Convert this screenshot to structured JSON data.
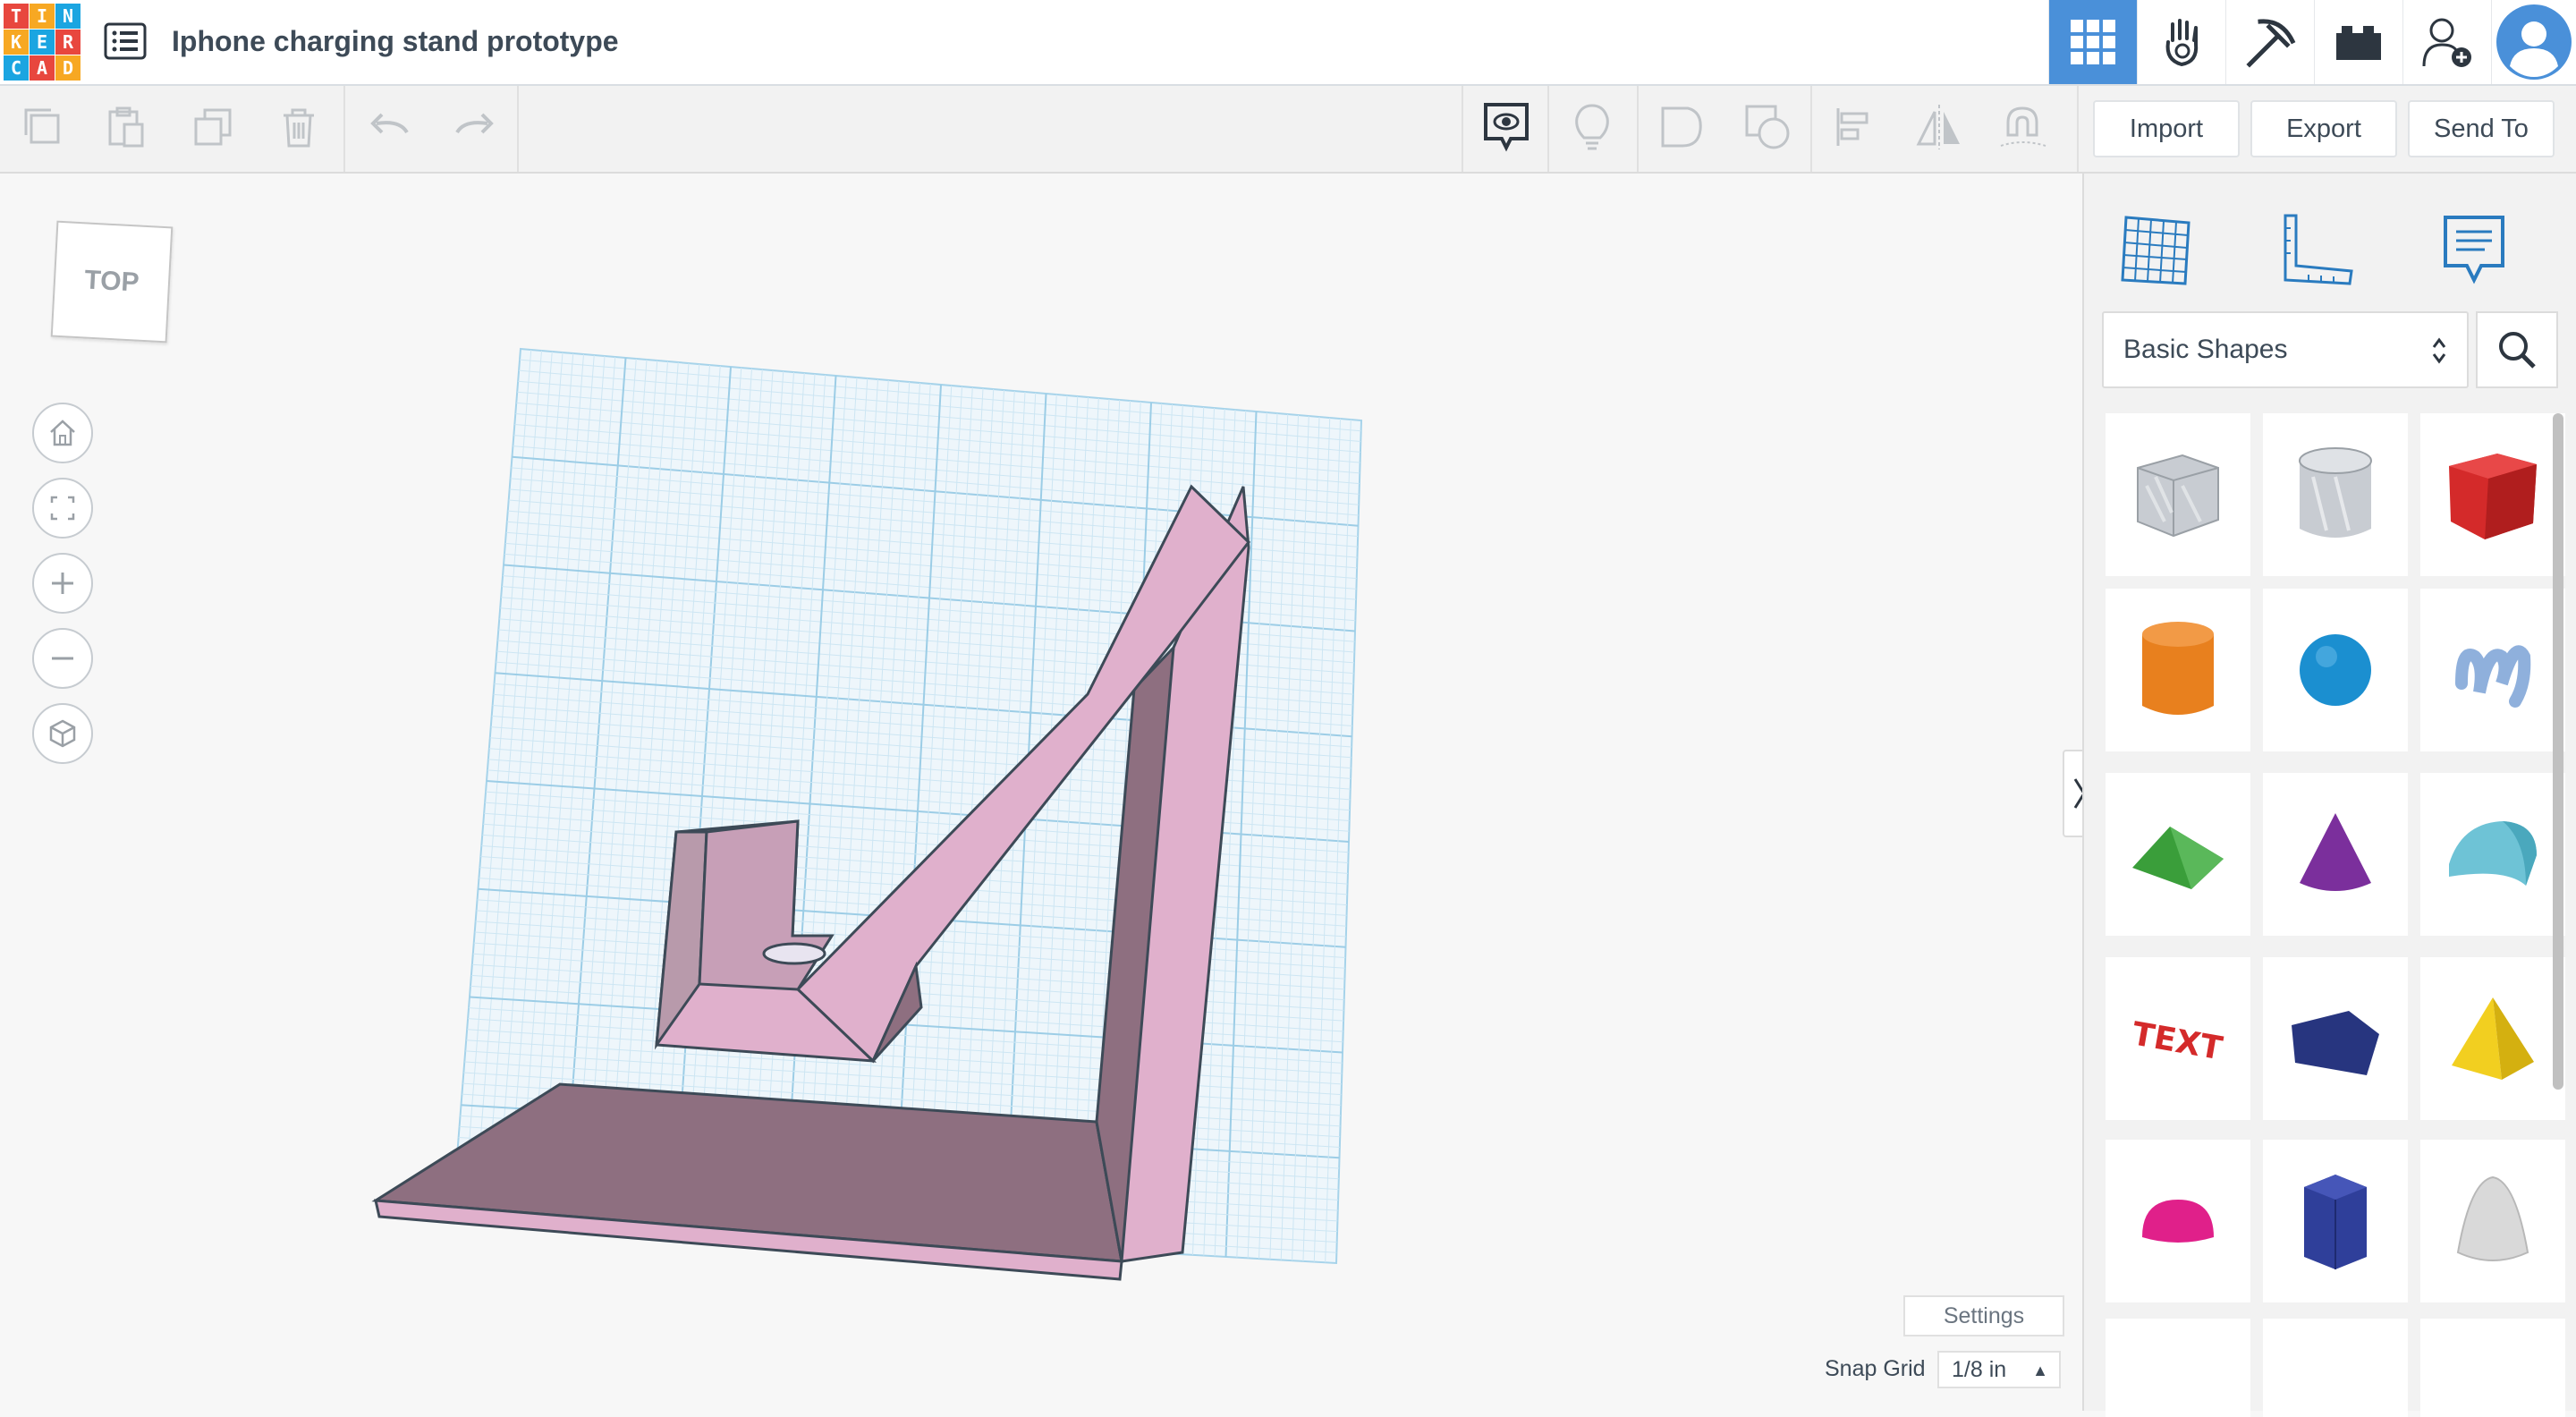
{
  "logo": {
    "letters": [
      "T",
      "I",
      "N",
      "K",
      "E",
      "R",
      "C",
      "A",
      "D"
    ],
    "colors": [
      "#e8473e",
      "#f7a823",
      "#1ba5e1",
      "#f7a823",
      "#1ba5e1",
      "#e8473e",
      "#1ba5e1",
      "#e8473e",
      "#f7a823"
    ]
  },
  "header": {
    "title": "Iphone charging stand prototype"
  },
  "top_icons": [
    "grid-view-icon",
    "gallery-hand-icon",
    "pickaxe-icon",
    "bricks-icon",
    "add-user-icon",
    "user-avatar-icon"
  ],
  "toolbar": {
    "import_label": "Import",
    "export_label": "Export",
    "send_to_label": "Send To",
    "icons": [
      "copy-icon",
      "paste-icon",
      "duplicate-icon",
      "delete-icon",
      "undo-icon",
      "redo-icon",
      "notes-toggle-icon",
      "light-bulb-icon",
      "hole-icon",
      "group-icon",
      "align-icon",
      "mirror-icon",
      "workplane-magnet-icon"
    ]
  },
  "viewcube": {
    "label": "TOP"
  },
  "nav_buttons": [
    "home-view-icon",
    "fit-view-icon",
    "zoom-in-icon",
    "zoom-out-icon",
    "projection-icon"
  ],
  "sidebar": {
    "tabs": [
      "workplane-icon",
      "ruler-icon",
      "notes-icon"
    ],
    "category": "Basic Shapes",
    "shapes": [
      {
        "name": "box-hole",
        "color": "#c8ccd2"
      },
      {
        "name": "cylinder-hole",
        "color": "#c8ccd2"
      },
      {
        "name": "box",
        "color": "#d42a2a"
      },
      {
        "name": "cylinder",
        "color": "#e8801e"
      },
      {
        "name": "sphere",
        "color": "#1b8fd0"
      },
      {
        "name": "scribble",
        "color": "#8fb0dc"
      },
      {
        "name": "roof",
        "color": "#3a9e3a"
      },
      {
        "name": "cone",
        "color": "#7b2f9c"
      },
      {
        "name": "round-roof",
        "color": "#6ec3d6"
      },
      {
        "name": "text",
        "color": "#d42a2a"
      },
      {
        "name": "polygon",
        "color": "#27357f"
      },
      {
        "name": "pyramid",
        "color": "#f2cf20"
      },
      {
        "name": "half-sphere",
        "color": "#e0208a"
      },
      {
        "name": "hexagonal-prism",
        "color": "#2f3f9a"
      },
      {
        "name": "paraboloid",
        "color": "#d9d9d9"
      }
    ]
  },
  "bottom": {
    "settings_label": "Settings",
    "snap_grid_label": "Snap Grid",
    "snap_grid_value": "1/8 in"
  },
  "colors": {
    "accent": "#4a90d9",
    "model": "#e0b0cc",
    "model_shadow": "#8e6f80",
    "grid": "#cfe8f4"
  }
}
